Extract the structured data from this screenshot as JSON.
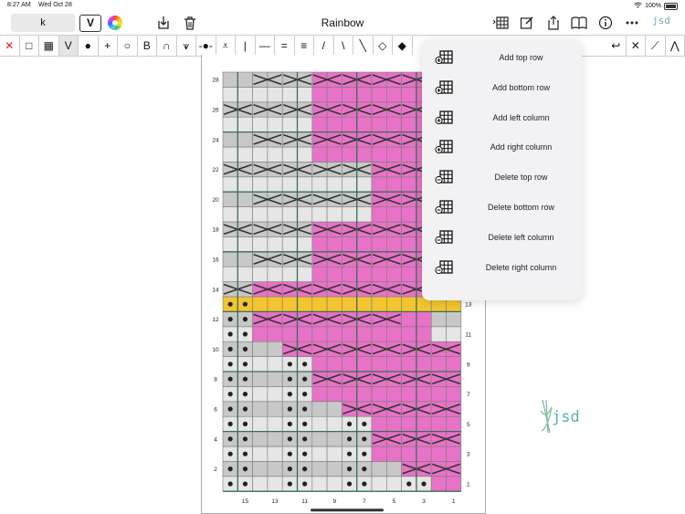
{
  "status": {
    "time": "8:27 AM",
    "date": "Wed Oct 28",
    "battery": "100%"
  },
  "nav": {
    "text_field": "k",
    "v_label": "V",
    "title": "Rainbow",
    "logo_small": "jsd"
  },
  "toolbar": {
    "tools": [
      {
        "name": "no-stitch-tool",
        "glyph": "✕"
      },
      {
        "name": "knit-tool",
        "glyph": "□"
      },
      {
        "name": "pattern-tool",
        "glyph": "▦"
      },
      {
        "name": "slip-tool",
        "glyph": "V"
      },
      {
        "name": "purl-tool",
        "glyph": "●"
      },
      {
        "name": "plus-tool",
        "glyph": "+"
      },
      {
        "name": "yarn-over-tool",
        "glyph": "○"
      },
      {
        "name": "bobble-tool",
        "glyph": "B"
      },
      {
        "name": "arch-tool",
        "glyph": "∩"
      },
      {
        "name": "cable-small-tool",
        "glyph": "⩛"
      },
      {
        "name": "purl-dot-tool",
        "glyph": "-●-"
      },
      {
        "name": "double-dec-tool",
        "glyph": "⩡"
      },
      {
        "name": "vertical-line-tool",
        "glyph": "|"
      },
      {
        "name": "dash-tool",
        "glyph": "—"
      },
      {
        "name": "double-dash-tool",
        "glyph": "="
      },
      {
        "name": "triple-dash-tool",
        "glyph": "≡"
      },
      {
        "name": "right-slant-tool",
        "glyph": "/"
      },
      {
        "name": "left-slant-tool",
        "glyph": "\\"
      },
      {
        "name": "left-slant-bold-tool",
        "glyph": "╲"
      },
      {
        "name": "diamond-tool",
        "glyph": "◇"
      },
      {
        "name": "filled-diamond-tool",
        "glyph": "◆"
      }
    ],
    "right_tools": [
      {
        "name": "turn-tool",
        "glyph": "↩"
      },
      {
        "name": "cross-tool",
        "glyph": "✕"
      },
      {
        "name": "long-slant-tool",
        "glyph": "⟋"
      },
      {
        "name": "cable-right-tool",
        "glyph": "⋀"
      }
    ]
  },
  "colors": {
    "pink": "#e872c7",
    "yellow": "#f4c531",
    "grey": "#c8c8c8",
    "light": "#e6e6e6",
    "grid": "#7a7a7a",
    "guide": "#3b6b58"
  },
  "chart": {
    "left_row_labels": [
      "28",
      "26",
      "24",
      "22",
      "20",
      "18",
      "16",
      "14",
      "12",
      "10",
      "8",
      "6",
      "4",
      "2"
    ],
    "right_row_labels": [
      "13",
      "11",
      "9",
      "7",
      "5",
      "3",
      "1"
    ],
    "bottom_col_labels": [
      "15",
      "13",
      "11",
      "9",
      "7",
      "5",
      "3",
      "1"
    ]
  },
  "menu": {
    "items": [
      "Add top row",
      "Add bottom row",
      "Add left column",
      "Add right column",
      "Delete top row",
      "Delete bottom row",
      "Delete left column",
      "Delete right column"
    ]
  },
  "logo_text": "jsd"
}
